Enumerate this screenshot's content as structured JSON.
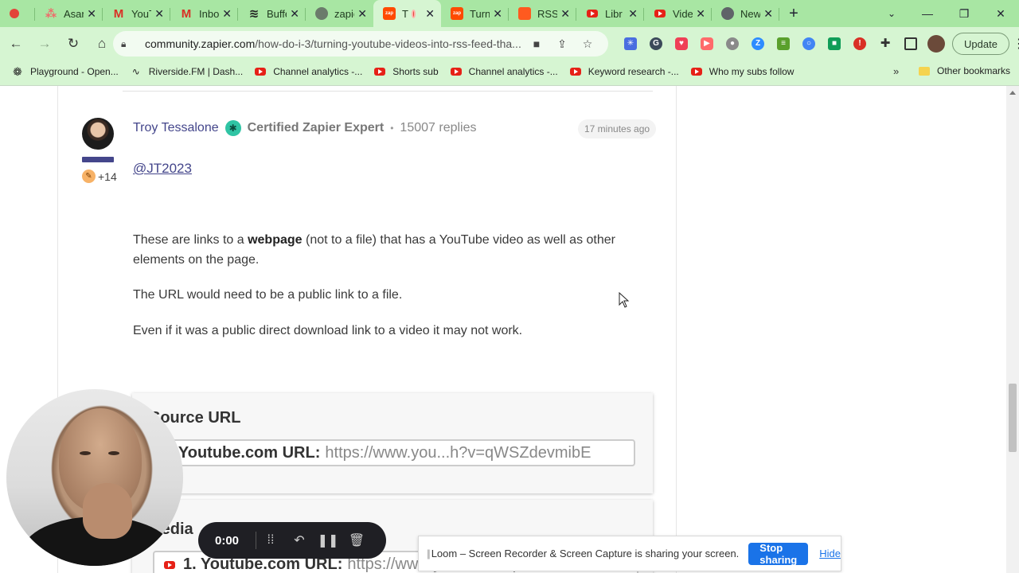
{
  "tabs": [
    {
      "title": "",
      "icon": "record-icon",
      "color": "#e2443a"
    },
    {
      "title": "Asana",
      "icon": "asana-icon",
      "color": "#f06a6a"
    },
    {
      "title": "YouTube",
      "icon": "gmail-icon",
      "color": "#d93025"
    },
    {
      "title": "Inbox",
      "icon": "gmail-icon",
      "color": "#d93025"
    },
    {
      "title": "Buffer",
      "icon": "buffer-icon",
      "color": "#222222"
    },
    {
      "title": "zapier",
      "icon": "globe-icon",
      "color": "#6b7b6b"
    },
    {
      "title": "T",
      "icon": "zapier-icon",
      "color": "#ff4a00",
      "active": true
    },
    {
      "title": "Turn",
      "icon": "zapier-icon",
      "color": "#ff4a00"
    },
    {
      "title": "RSS",
      "icon": "rss-icon",
      "color": "#ff5a1f"
    },
    {
      "title": "Libr",
      "icon": "youtube-icon",
      "color": "#e62117"
    },
    {
      "title": "Vide",
      "icon": "youtube-icon",
      "color": "#e62117"
    },
    {
      "title": "New",
      "icon": "chrome-icon",
      "color": "#5f6368"
    }
  ],
  "toolbar": {
    "url_host": "community.zapier.com",
    "url_path": "/how-do-i-3/turning-youtube-videos-into-rss-feed-tha...",
    "update_label": "Update"
  },
  "bookmarks": [
    {
      "label": "Playground - Open...",
      "icon": "openai-icon"
    },
    {
      "label": "Riverside.FM | Dash...",
      "icon": "riverside-icon"
    },
    {
      "label": "Channel analytics -...",
      "icon": "youtube-icon"
    },
    {
      "label": "Shorts sub",
      "icon": "youtube-icon"
    },
    {
      "label": "Channel analytics -...",
      "icon": "youtube-icon"
    },
    {
      "label": "Keyword research -...",
      "icon": "youtube-icon"
    },
    {
      "label": "Who my subs follow",
      "icon": "youtube-icon"
    }
  ],
  "bookmarks_more": "»",
  "other_bookmarks": "Other bookmarks",
  "post": {
    "author": "Troy Tessalone",
    "rank": "Certified Zapier Expert",
    "replies": "15007 replies",
    "time": "17 minutes ago",
    "badge_count": "+14",
    "mention": "@JT2023",
    "p1_before": "These are links to a ",
    "p1_bold": "webpage",
    "p1_after": " (not to a file) that has a YouTube video as well as other elements on the page.",
    "p2": "The URL would need to be a public link to a file.",
    "p3": "Even if it was a public direct download link to a video it may not work."
  },
  "screenshot1": {
    "title": "Source URL",
    "field_label": "1. Youtube.com URL:",
    "field_value": "https://www.you...h?v=qWSZdevmibE"
  },
  "screenshot2": {
    "title": "Media",
    "field_label": "1. Youtube.com URL:",
    "field_value": "https://www.you...h?v=qWSZdevmibE"
  },
  "loom": {
    "time": "0:00",
    "share_message": "Loom – Screen Recorder & Screen Capture is sharing your screen.",
    "stop_label": "Stop sharing",
    "hide_label": "Hide"
  }
}
